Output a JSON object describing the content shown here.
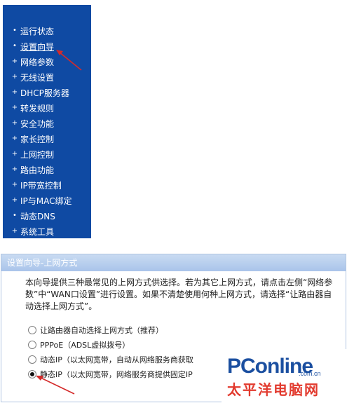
{
  "sidebar": {
    "items": [
      {
        "bullet": "•",
        "label": "运行状态"
      },
      {
        "bullet": "•",
        "label": "设置向导"
      },
      {
        "bullet": "+",
        "label": "网络参数"
      },
      {
        "bullet": "+",
        "label": "无线设置"
      },
      {
        "bullet": "+",
        "label": "DHCP服务器"
      },
      {
        "bullet": "+",
        "label": "转发规则"
      },
      {
        "bullet": "+",
        "label": "安全功能"
      },
      {
        "bullet": "+",
        "label": "家长控制"
      },
      {
        "bullet": "+",
        "label": "上网控制"
      },
      {
        "bullet": "+",
        "label": "路由功能"
      },
      {
        "bullet": "+",
        "label": "IP带宽控制"
      },
      {
        "bullet": "+",
        "label": "IP与MAC绑定"
      },
      {
        "bullet": "•",
        "label": "动态DNS"
      },
      {
        "bullet": "+",
        "label": "系统工具"
      }
    ]
  },
  "panel": {
    "title": "设置向导-上网方式",
    "description": "本向导提供三种最常见的上网方式供选择。若为其它上网方式，请点击左侧“网络参数”中“WAN口设置”进行设置。如果不清楚使用何种上网方式，请选择“让路由器自动选择上网方式”。",
    "options": [
      {
        "label": "让路由器自动选择上网方式（推荐）",
        "checked": false
      },
      {
        "label": "PPPoE（ADSL虚拟拨号）",
        "checked": false
      },
      {
        "label": "动态IP（以太网宽带，自动从网络服务商获取",
        "checked": false
      },
      {
        "label": "静态IP（以太网宽带，网络服务商提供固定IP",
        "checked": true
      }
    ]
  },
  "watermark": {
    "brand": "PConline",
    "domain": ".com.cn",
    "chinese": "太平洋电脑网"
  },
  "colors": {
    "sidebar_bg": "#0f4aa3",
    "title_bar": "#a9c4ea",
    "arrow": "#d42a2a",
    "brand_blue": "#1b4fa0",
    "brand_red": "#e23a2e"
  }
}
